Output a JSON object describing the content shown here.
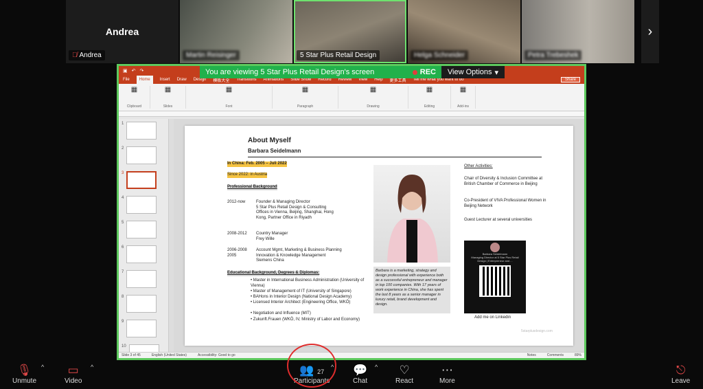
{
  "participants": [
    {
      "name": "Andrea",
      "display_name": "Andrea",
      "muted": true
    },
    {
      "name": "Martin Reisinger",
      "blurred": true
    },
    {
      "name": "5 Star Plus Retail Design",
      "active": true
    },
    {
      "name": "Helga Schneider",
      "blurred": true
    },
    {
      "name": "Petra Trebeshek",
      "blurred": true
    }
  ],
  "share_banner": {
    "text": "You are viewing  5 Star Plus Retail Design's screen",
    "rec": "REC",
    "view_options": "View Options"
  },
  "ppt": {
    "tabs": [
      "File",
      "Home",
      "Insert",
      "Draw",
      "Design",
      "模板大全",
      "Transitions",
      "Animations",
      "Slide Show",
      "Record",
      "Review",
      "View",
      "Help",
      "更多工具"
    ],
    "tell_me": "Tell me what you want to do",
    "share": "Share",
    "groups": [
      "Clipboard",
      "Slides",
      "Font",
      "Paragraph",
      "Drawing",
      "Editing",
      "Add-ins"
    ],
    "status": {
      "slide": "Slide 3 of 45",
      "lang": "English (United States)",
      "access": "Accessibility: Good to go",
      "notes": "Notes",
      "comments": "Comments",
      "zoom": "89%"
    }
  },
  "thumbnails": [
    "1",
    "2",
    "3",
    "4",
    "5",
    "6",
    "7",
    "8",
    "9",
    "10"
  ],
  "slide": {
    "title": "About Myself",
    "name": "Barbara Seidelmann",
    "china": "In China: Feb. 2005 – Juli 2022",
    "austria": "Since 2022: in Austria",
    "prof": "Professional Background",
    "jobs": [
      {
        "year": "2012-now",
        "text": "Founder & Managing Director\n5 Star Plus Retail Design & Consulting\nOffices in Vienna, Beijing, Shanghai, Hong\nKong, Partner Office in Riyadh"
      },
      {
        "year": "2008-2012",
        "text": "Country Manager\nFrey Wille"
      },
      {
        "year": "2006-2008\n2005",
        "text": "Account Mgmt, Marketing & Business Planning\nInnovation & Knowledge Management\nSiemens China"
      }
    ],
    "edu_title": "Educational Background, Degrees & Diplomas:",
    "edu": [
      "Master in International Business Administration (University of Vienna)",
      "Master of Management of IT (University of Singapore)",
      "BAHons in Interior Design (National Design Academy)",
      "Licensed Interior Architect (Engineering Office, WKÖ)",
      "Negotiation and Influence (MIT)",
      "Zukunft.Frauen (WKÖ, IV, Ministry of Labor and Economy)"
    ],
    "caption": "Barbara is a marketing, strategy and design professional with experience both as a successful entrepreneur and manager in top 100 companies. With 17 years of work experience in China, she has spent the last 8 years as a senior manager in luxury retail, brand development and design.",
    "other_title": "Other Activities:",
    "other": [
      "Chair of Diversity & Inclusion Committee at British Chamber of Commerce in Beijing",
      "Co-President of VIVA Professional Women in Beijing Network",
      "Guest Lecturer at several universities"
    ],
    "qr_name": "Barbara Seidelmann",
    "qr_sub": "Managing Director at 5 Star Plus Retail Design | Entrepreneur and ...",
    "linkedin": "Add me on Linkedin",
    "footer": "5starplusdesign.com"
  },
  "toolbar": {
    "unmute": "Unmute",
    "video": "Video",
    "participants": "Participants",
    "participant_count": "27",
    "chat": "Chat",
    "react": "React",
    "more": "More",
    "leave": "Leave"
  },
  "colors": {
    "share_border": "#5ec95e",
    "ppt_red": "#c43e1c",
    "banner_green": "#21b14b",
    "highlight": "#f5c342",
    "circle": "#e02d2d"
  }
}
